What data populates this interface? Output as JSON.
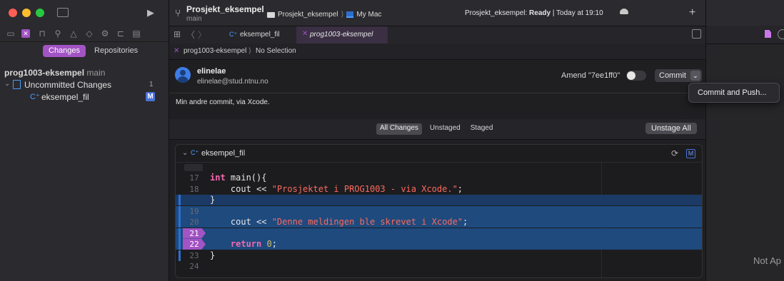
{
  "sidebar": {
    "tabs": [
      "Changes",
      "Repositories"
    ],
    "repo": {
      "name": "prog1003-eksempel",
      "branch": "main"
    },
    "group": {
      "label": "Uncommitted Changes",
      "count": "1"
    },
    "file": {
      "label": "eksempel_fil",
      "badge": "M"
    }
  },
  "toolbar": {
    "project": "Prosjekt_eksempel",
    "branch": "main",
    "scheme": "Prosjekt_eksempel",
    "destination": "My Mac",
    "status_label": "Prosjekt_eksempel:",
    "status_state": "Ready",
    "status_time": "| Today at 19:10",
    "add": "+"
  },
  "tabs": [
    {
      "label": "eksempel_fil"
    },
    {
      "label": "prog1003-eksempel"
    }
  ],
  "breadcrumb": {
    "repo": "prog1003-eksempel",
    "selection": "No Selection"
  },
  "commit": {
    "author_name": "elinelae",
    "author_email": "elinelae@stud.ntnu.no",
    "amend_label": "Amend \"7ee1ff0\"",
    "commit_label": "Commit",
    "message": "Min andre commit, via Xcode.",
    "menu_item": "Commit and Push..."
  },
  "filters": {
    "options": [
      "All Changes",
      "Unstaged",
      "Staged"
    ],
    "unstage_all": "Unstage All"
  },
  "diff": {
    "file_name": "eksempel_fil",
    "badge": "M",
    "lines": [
      {
        "n": "17",
        "parts": [
          [
            "kw",
            "int"
          ],
          [
            "t",
            " main(){"
          ]
        ]
      },
      {
        "n": "18",
        "parts": [
          [
            "t",
            "    cout << "
          ],
          [
            "str",
            "\"Prosjektet i PROG1003 - via Xcode.\""
          ],
          [
            "t",
            ";"
          ]
        ]
      },
      {
        "n": "",
        "parts": [
          [
            "t",
            "}"
          ]
        ]
      },
      {
        "n": "19",
        "parts": []
      },
      {
        "n": "20",
        "parts": [
          [
            "t",
            "    cout << "
          ],
          [
            "str",
            "\"Denne meldingen ble skrevet i Xcode\""
          ],
          [
            "t",
            ";"
          ]
        ]
      },
      {
        "n": "21",
        "parts": []
      },
      {
        "n": "22",
        "parts": [
          [
            "t",
            "    "
          ],
          [
            "kw",
            "return"
          ],
          [
            "t",
            " "
          ],
          [
            "num",
            "0"
          ],
          [
            "t",
            ";"
          ]
        ]
      },
      {
        "n": "23",
        "parts": [
          [
            "t",
            "}"
          ]
        ]
      },
      {
        "n": "24",
        "parts": []
      }
    ]
  },
  "right_panel": {
    "placeholder": "Not Ap"
  },
  "colors": {
    "accent": "#a253c4",
    "selection": "#1e4a7e",
    "gutter_mark": "#2f6fcf"
  }
}
